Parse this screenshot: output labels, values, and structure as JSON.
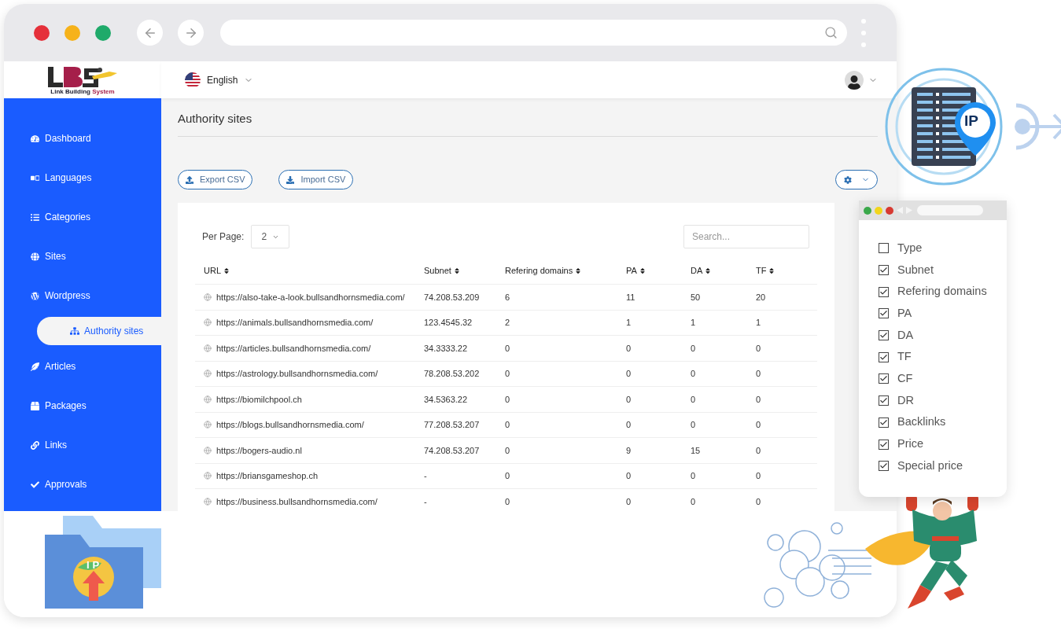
{
  "brand": {
    "name": "Link Building",
    "accent": "System"
  },
  "language": {
    "label": "English"
  },
  "sidebar": {
    "items": [
      {
        "label": "Dashboard",
        "selected": false
      },
      {
        "label": "Languages",
        "selected": false
      },
      {
        "label": "Categories",
        "selected": false
      },
      {
        "label": "Sites",
        "selected": false
      },
      {
        "label": "Wordpress",
        "selected": false,
        "children": [
          {
            "label": "Authority sites",
            "selected": true
          }
        ]
      },
      {
        "label": "Articles",
        "selected": false
      },
      {
        "label": "Packages",
        "selected": false
      },
      {
        "label": "Links",
        "selected": false
      },
      {
        "label": "Approvals",
        "selected": false
      }
    ]
  },
  "page": {
    "title": "Authority sites"
  },
  "actions": [
    {
      "label": "Export CSV",
      "kind": "export"
    },
    {
      "label": "Import CSV",
      "kind": "import"
    }
  ],
  "per_page": {
    "label": "Per Page:",
    "value": "2"
  },
  "search": {
    "placeholder": "Search..."
  },
  "table": {
    "columns": [
      "URL",
      "Subnet",
      "Refering domains",
      "PA",
      "DA",
      "TF"
    ],
    "rows": [
      [
        "https://also-take-a-look.bullsandhornsmedia.com/",
        "74.208.53.209",
        "6",
        "11",
        "50",
        "20"
      ],
      [
        "https://animals.bullsandhornsmedia.com/",
        "123.4545.32",
        "2",
        "1",
        "1",
        "1"
      ],
      [
        "https://articles.bullsandhornsmedia.com/",
        "34.3333.22",
        "0",
        "0",
        "0",
        "0"
      ],
      [
        "https://astrology.bullsandhornsmedia.com/",
        "78.208.53.202",
        "0",
        "0",
        "0",
        "0"
      ],
      [
        "https://biomilchpool.ch",
        "34.5363.22",
        "0",
        "0",
        "0",
        "0"
      ],
      [
        "https://blogs.bullsandhornsmedia.com/",
        "77.208.53.207",
        "0",
        "0",
        "0",
        "0"
      ],
      [
        "https://bogers-audio.nl",
        "74.208.53.207",
        "0",
        "9",
        "15",
        "0"
      ],
      [
        "https://briansgameshop.ch",
        "-",
        "0",
        "0",
        "0",
        "0"
      ],
      [
        "https://business.bullsandhornsmedia.com/",
        "-",
        "0",
        "0",
        "0",
        "0"
      ]
    ]
  },
  "column_menu": {
    "items": [
      {
        "label": "Type",
        "checked": false
      },
      {
        "label": "Subnet",
        "checked": true
      },
      {
        "label": "Refering domains",
        "checked": true
      },
      {
        "label": "PA",
        "checked": true
      },
      {
        "label": "DA",
        "checked": true
      },
      {
        "label": "TF",
        "checked": true
      },
      {
        "label": "CF",
        "checked": true
      },
      {
        "label": "DR",
        "checked": true
      },
      {
        "label": "Backlinks",
        "checked": true
      },
      {
        "label": "Price",
        "checked": true
      },
      {
        "label": "Special price",
        "checked": true
      }
    ]
  },
  "illustrations": {
    "server_badge": "IP",
    "folder_badge": "IP"
  }
}
